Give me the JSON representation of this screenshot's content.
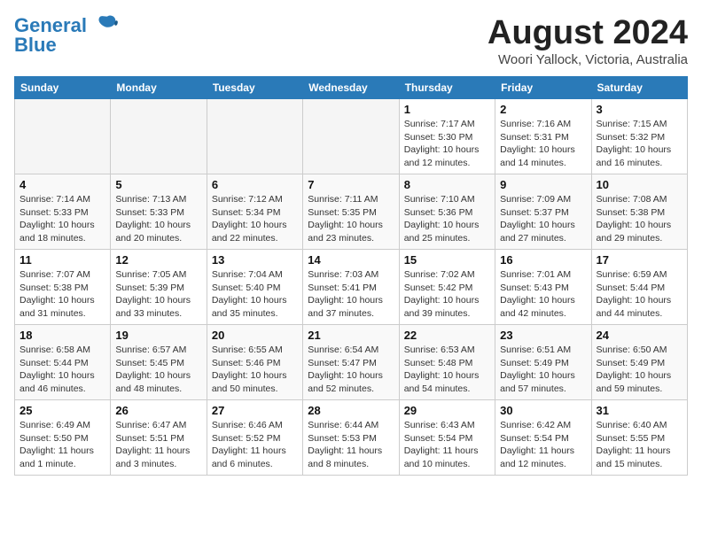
{
  "header": {
    "logo_line1": "General",
    "logo_line2": "Blue",
    "month_year": "August 2024",
    "location": "Woori Yallock, Victoria, Australia"
  },
  "days_of_week": [
    "Sunday",
    "Monday",
    "Tuesday",
    "Wednesday",
    "Thursday",
    "Friday",
    "Saturday"
  ],
  "weeks": [
    [
      {
        "day": "",
        "empty": true
      },
      {
        "day": "",
        "empty": true
      },
      {
        "day": "",
        "empty": true
      },
      {
        "day": "",
        "empty": true
      },
      {
        "day": "1",
        "sunrise": "7:17 AM",
        "sunset": "5:30 PM",
        "daylight": "10 hours and 12 minutes."
      },
      {
        "day": "2",
        "sunrise": "7:16 AM",
        "sunset": "5:31 PM",
        "daylight": "10 hours and 14 minutes."
      },
      {
        "day": "3",
        "sunrise": "7:15 AM",
        "sunset": "5:32 PM",
        "daylight": "10 hours and 16 minutes."
      }
    ],
    [
      {
        "day": "4",
        "sunrise": "7:14 AM",
        "sunset": "5:33 PM",
        "daylight": "10 hours and 18 minutes."
      },
      {
        "day": "5",
        "sunrise": "7:13 AM",
        "sunset": "5:33 PM",
        "daylight": "10 hours and 20 minutes."
      },
      {
        "day": "6",
        "sunrise": "7:12 AM",
        "sunset": "5:34 PM",
        "daylight": "10 hours and 22 minutes."
      },
      {
        "day": "7",
        "sunrise": "7:11 AM",
        "sunset": "5:35 PM",
        "daylight": "10 hours and 23 minutes."
      },
      {
        "day": "8",
        "sunrise": "7:10 AM",
        "sunset": "5:36 PM",
        "daylight": "10 hours and 25 minutes."
      },
      {
        "day": "9",
        "sunrise": "7:09 AM",
        "sunset": "5:37 PM",
        "daylight": "10 hours and 27 minutes."
      },
      {
        "day": "10",
        "sunrise": "7:08 AM",
        "sunset": "5:38 PM",
        "daylight": "10 hours and 29 minutes."
      }
    ],
    [
      {
        "day": "11",
        "sunrise": "7:07 AM",
        "sunset": "5:38 PM",
        "daylight": "10 hours and 31 minutes."
      },
      {
        "day": "12",
        "sunrise": "7:05 AM",
        "sunset": "5:39 PM",
        "daylight": "10 hours and 33 minutes."
      },
      {
        "day": "13",
        "sunrise": "7:04 AM",
        "sunset": "5:40 PM",
        "daylight": "10 hours and 35 minutes."
      },
      {
        "day": "14",
        "sunrise": "7:03 AM",
        "sunset": "5:41 PM",
        "daylight": "10 hours and 37 minutes."
      },
      {
        "day": "15",
        "sunrise": "7:02 AM",
        "sunset": "5:42 PM",
        "daylight": "10 hours and 39 minutes."
      },
      {
        "day": "16",
        "sunrise": "7:01 AM",
        "sunset": "5:43 PM",
        "daylight": "10 hours and 42 minutes."
      },
      {
        "day": "17",
        "sunrise": "6:59 AM",
        "sunset": "5:44 PM",
        "daylight": "10 hours and 44 minutes."
      }
    ],
    [
      {
        "day": "18",
        "sunrise": "6:58 AM",
        "sunset": "5:44 PM",
        "daylight": "10 hours and 46 minutes."
      },
      {
        "day": "19",
        "sunrise": "6:57 AM",
        "sunset": "5:45 PM",
        "daylight": "10 hours and 48 minutes."
      },
      {
        "day": "20",
        "sunrise": "6:55 AM",
        "sunset": "5:46 PM",
        "daylight": "10 hours and 50 minutes."
      },
      {
        "day": "21",
        "sunrise": "6:54 AM",
        "sunset": "5:47 PM",
        "daylight": "10 hours and 52 minutes."
      },
      {
        "day": "22",
        "sunrise": "6:53 AM",
        "sunset": "5:48 PM",
        "daylight": "10 hours and 54 minutes."
      },
      {
        "day": "23",
        "sunrise": "6:51 AM",
        "sunset": "5:49 PM",
        "daylight": "10 hours and 57 minutes."
      },
      {
        "day": "24",
        "sunrise": "6:50 AM",
        "sunset": "5:49 PM",
        "daylight": "10 hours and 59 minutes."
      }
    ],
    [
      {
        "day": "25",
        "sunrise": "6:49 AM",
        "sunset": "5:50 PM",
        "daylight": "11 hours and 1 minute."
      },
      {
        "day": "26",
        "sunrise": "6:47 AM",
        "sunset": "5:51 PM",
        "daylight": "11 hours and 3 minutes."
      },
      {
        "day": "27",
        "sunrise": "6:46 AM",
        "sunset": "5:52 PM",
        "daylight": "11 hours and 6 minutes."
      },
      {
        "day": "28",
        "sunrise": "6:44 AM",
        "sunset": "5:53 PM",
        "daylight": "11 hours and 8 minutes."
      },
      {
        "day": "29",
        "sunrise": "6:43 AM",
        "sunset": "5:54 PM",
        "daylight": "11 hours and 10 minutes."
      },
      {
        "day": "30",
        "sunrise": "6:42 AM",
        "sunset": "5:54 PM",
        "daylight": "11 hours and 12 minutes."
      },
      {
        "day": "31",
        "sunrise": "6:40 AM",
        "sunset": "5:55 PM",
        "daylight": "11 hours and 15 minutes."
      }
    ]
  ]
}
